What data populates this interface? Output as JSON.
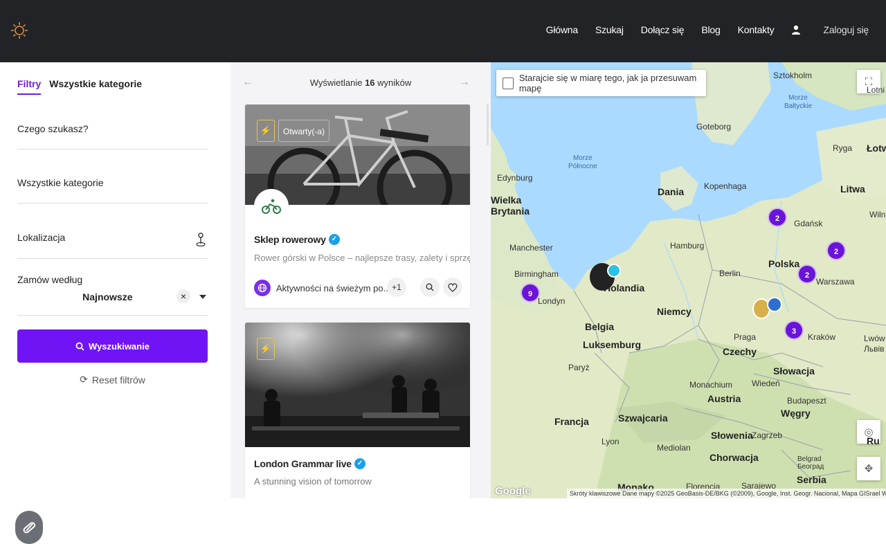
{
  "nav": {
    "items": [
      "Główna",
      "Szukaj",
      "Dołącz się",
      "Blog",
      "Kontakty"
    ],
    "login": "Zaloguj się"
  },
  "filters": {
    "tab_active": "Filtry",
    "tab_other": "Wszystkie kategorie",
    "query_label": "Czego szukasz?",
    "category_label": "Wszystkie kategorie",
    "location_label": "Lokalizacja",
    "order_label": "Zamów według",
    "order_value": "Najnowsze",
    "search_button": "Wyszukiwanie",
    "reset_label": "Reset filtrów"
  },
  "results": {
    "prefix": "Wyświetlanie",
    "count": "16",
    "suffix": "wyników",
    "cards": [
      {
        "title": "Sklep rowerowy",
        "description": "Rower górski w Polsce – najlepsze trasy, zalety i sprzęt ...",
        "status": "Otwarty(-a)",
        "category": "Aktywności na świeżym po...",
        "extra": "+1"
      },
      {
        "title": "London Grammar live",
        "description": "A stunning vision of tomorrow"
      }
    ]
  },
  "map": {
    "checkbox_label": "Starajcie się w miarę tego, jak ja przesuwam mapę",
    "clusters": [
      "2",
      "2",
      "2",
      "9",
      "3"
    ],
    "seas": {
      "north": "Morze\nPółnocne",
      "baltic": "Morze\nBałtyckie"
    },
    "countries": [
      "Dania",
      "Litwa",
      "Polska",
      "Niemcy",
      "Belgia",
      "Luksemburg",
      "Czechy",
      "Słowacja",
      "Austria",
      "Węgry",
      "Francja",
      "Szwajcaria",
      "Słowenia",
      "Chorwacja",
      "Serbia",
      "Monako",
      "Holandia",
      "Wielka\nBrytania",
      "Łotw",
      "Ru"
    ],
    "cities": [
      "Sztokholm",
      "Goteborg",
      "Ryga",
      "Edynburg",
      "Kopenhaga",
      "Gdańsk",
      "Wiln",
      "Manchester",
      "Hamburg",
      "Birmingham",
      "Londyn",
      "Berlin",
      "Warszawa",
      "Praga",
      "Kraków",
      "Lwów\nЛьвів",
      "Paryż",
      "Monachium",
      "Wiedeń",
      "Budapeszt",
      "Lyon",
      "Mediolan",
      "Florencja",
      "Sarajewo",
      "Belgrad\nБеоград",
      "Zagrzeb",
      "Lotni"
    ],
    "google": "Google",
    "attribution": "Skróty klawiszowe    Dane mapy ©2025 GeoBasis-DE/BKG (©2009), Google, Inst. Geogr. Nacional, Mapa GISrael    Warunki"
  }
}
